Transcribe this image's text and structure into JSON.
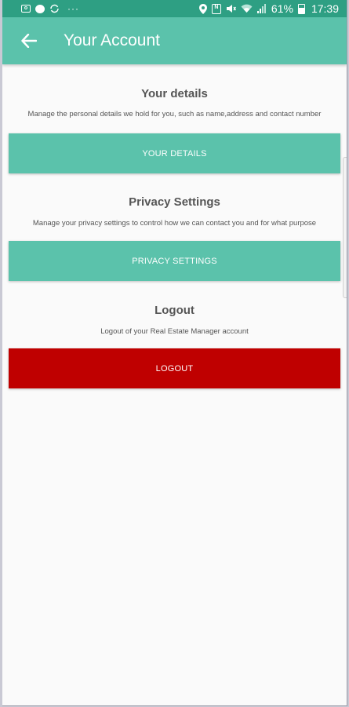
{
  "status_bar": {
    "battery_percent": "61%",
    "time": "17:39",
    "overflow": "···"
  },
  "app_bar": {
    "title": "Your Account"
  },
  "sections": [
    {
      "title": "Your details",
      "description": "Manage the personal details we hold for you, such as name,address and contact number",
      "button_label": "YOUR DETAILS",
      "button_color": "#5bc2ab"
    },
    {
      "title": "Privacy Settings",
      "description": "Manage your privacy settings to control how we can contact you and for what purpose",
      "button_label": "PRIVACY SETTINGS",
      "button_color": "#5bc2ab"
    },
    {
      "title": "Logout",
      "description": "Logout of your Real Estate Manager account",
      "button_label": "LOGOUT",
      "button_color": "#bf0000"
    }
  ],
  "colors": {
    "status_bar": "#2e9f83",
    "accent": "#5bc2ab",
    "danger": "#bf0000",
    "background": "#fafafa"
  }
}
